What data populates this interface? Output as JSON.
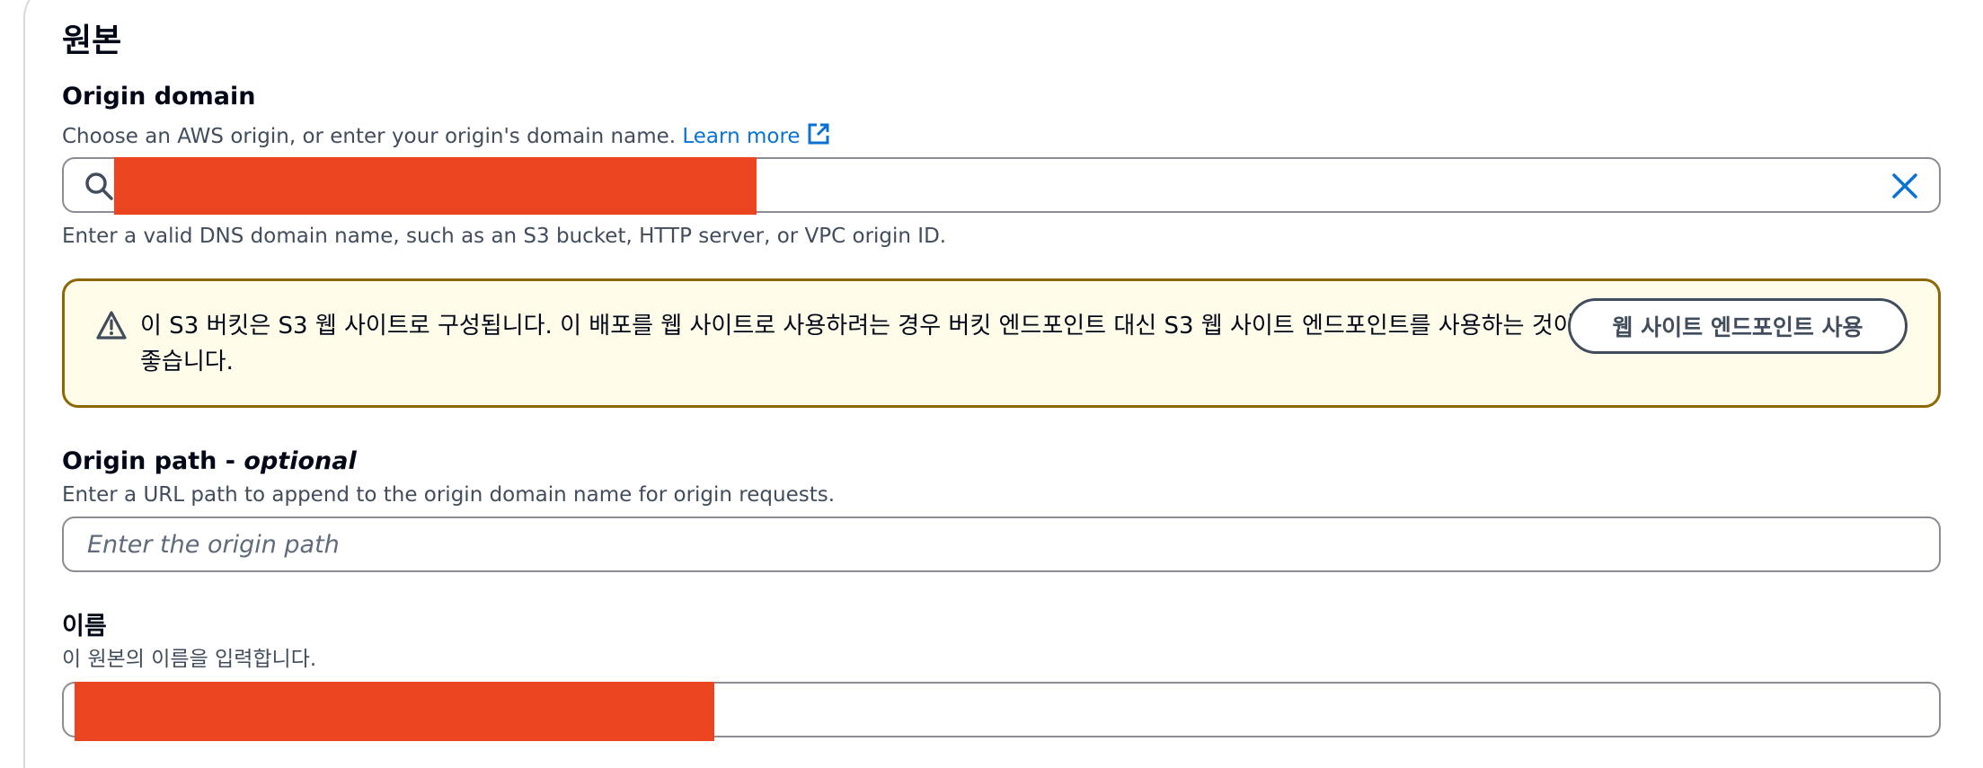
{
  "section": {
    "title": "원본"
  },
  "origin_domain": {
    "label": "Origin domain",
    "description": "Choose an AWS origin, or enter your origin's domain name.",
    "learn_more": "Learn more",
    "constraint": "Enter a valid DNS domain name, such as an S3 bucket, HTTP server, or VPC origin ID."
  },
  "alert": {
    "message": "이 S3 버킷은 S3 웹 사이트로 구성됩니다. 이 배포를 웹 사이트로 사용하려는 경우 버킷 엔드포인트 대신 S3 웹 사이트 엔드포인트를 사용하는 것이 좋습니다.",
    "button_label": "웹 사이트 엔드포인트 사용"
  },
  "origin_path": {
    "label": "Origin path - ",
    "label_optional": "optional",
    "description": "Enter a URL path to append to the origin domain name for origin requests.",
    "placeholder": "Enter the origin path"
  },
  "name_field": {
    "label": "이름",
    "description": "이 원본의 이름을 입력합니다."
  },
  "colors": {
    "link": "#0972d3",
    "alert_border": "#8d6605",
    "alert_background": "#fffce9",
    "redaction": "#ea4420"
  }
}
